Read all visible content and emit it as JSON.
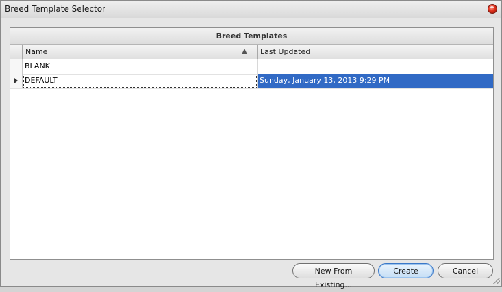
{
  "window": {
    "title": "Breed Template Selector"
  },
  "grid": {
    "caption": "Breed Templates",
    "columns": [
      {
        "label": "Name",
        "sort": "ascending"
      },
      {
        "label": "Last Updated"
      }
    ],
    "rows": [
      {
        "name": "BLANK",
        "last_updated": "",
        "selected": false
      },
      {
        "name": "DEFAULT",
        "last_updated": "Sunday, January 13, 2013 9:29 PM",
        "selected": true
      }
    ]
  },
  "buttons": {
    "new_from_existing": "New From Existing...",
    "create": "Create",
    "cancel": "Cancel"
  },
  "colors": {
    "selection": "#316ac5",
    "close_button": "#e0301c"
  },
  "icons": [
    "close-icon",
    "sort-ascending-icon",
    "row-pointer-icon",
    "resize-grip-icon"
  ]
}
